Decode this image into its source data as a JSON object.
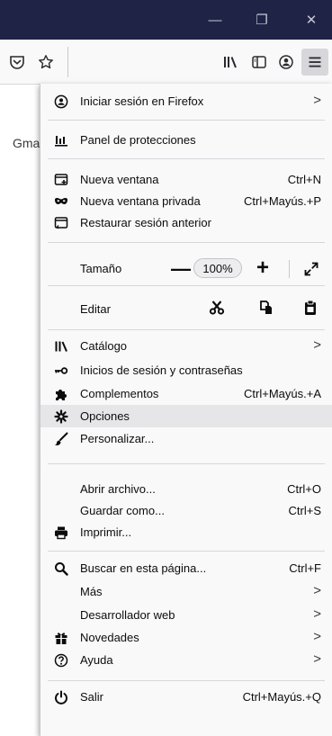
{
  "browser": {
    "window_controls": {
      "minimize": "—",
      "restore": "❐",
      "close": "✕"
    },
    "background_text": "Gma"
  },
  "toolbar_icons": [
    "pocket-icon",
    "bookmark-star-icon",
    "library-icon",
    "sidebar-icon",
    "account-icon",
    "hamburger-menu-icon"
  ],
  "menu": {
    "sign_in": {
      "label": "Iniciar sesión en Firefox",
      "arrow": ">"
    },
    "protections": {
      "label": "Panel de protecciones"
    },
    "new_window": {
      "label": "Nueva ventana",
      "shortcut": "Ctrl+N"
    },
    "private_window": {
      "label": "Nueva ventana privada",
      "shortcut": "Ctrl+Mayús.+P"
    },
    "restore_session": {
      "label": "Restaurar sesión anterior"
    },
    "zoom": {
      "label": "Tamaño",
      "minus": "—",
      "value": "100%",
      "plus": "+"
    },
    "edit": {
      "label": "Editar"
    },
    "library": {
      "label": "Catálogo",
      "arrow": ">"
    },
    "logins": {
      "label": "Inicios de sesión y contraseñas"
    },
    "addons": {
      "label": "Complementos",
      "shortcut": "Ctrl+Mayús.+A"
    },
    "options": {
      "label": "Opciones"
    },
    "customize": {
      "label": "Personalizar..."
    },
    "open_file": {
      "label": "Abrir archivo...",
      "shortcut": "Ctrl+O"
    },
    "save_as": {
      "label": "Guardar como...",
      "shortcut": "Ctrl+S"
    },
    "print": {
      "label": "Imprimir..."
    },
    "find": {
      "label": "Buscar en esta página...",
      "shortcut": "Ctrl+F"
    },
    "more": {
      "label": "Más",
      "arrow": ">"
    },
    "web_developer": {
      "label": "Desarrollador web",
      "arrow": ">"
    },
    "whats_new": {
      "label": "Novedades",
      "arrow": ">"
    },
    "help": {
      "label": "Ayuda",
      "arrow": ">"
    },
    "quit": {
      "label": "Salir",
      "shortcut": "Ctrl+Mayús.+Q"
    }
  },
  "colors": {
    "titlebar": "#1f2346",
    "menu_bg": "#f9f9fa",
    "hover_bg": "#e6e6e8"
  }
}
